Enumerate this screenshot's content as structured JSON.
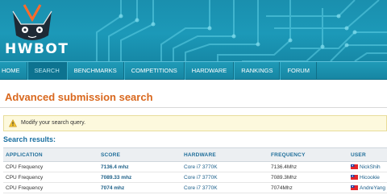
{
  "header": {
    "logo_text": "HWBOT",
    "logo_icon": "cat-face-icon",
    "colors": {
      "banner": "#1a8fae",
      "accent_orange": "#d9681e",
      "link_blue": "#1a6fa0"
    }
  },
  "nav": {
    "items": [
      {
        "label": "HOME",
        "active": false
      },
      {
        "label": "SEARCH",
        "active": true
      },
      {
        "label": "BENCHMARKS",
        "active": false
      },
      {
        "label": "COMPETITIONS",
        "active": false
      },
      {
        "label": "HARDWARE",
        "active": false
      },
      {
        "label": "RANKINGS",
        "active": false
      },
      {
        "label": "FORUM",
        "active": false
      }
    ]
  },
  "page": {
    "title": "Advanced submission search"
  },
  "notice": {
    "icon": "warning-icon",
    "text": "Modify your search query."
  },
  "results": {
    "title": "Search results:",
    "columns": [
      "APPLICATION",
      "SCORE",
      "HARDWARE",
      "FREQUENCY",
      "USER"
    ],
    "rows": [
      {
        "application": "CPU Frequency",
        "score": "7136.4 mhz",
        "hardware": "Core i7 3770K",
        "frequency": "7136.4Mhz",
        "flag": "taiwan-flag-icon",
        "user": "NickShih"
      },
      {
        "application": "CPU Frequency",
        "score": "7089.33 mhz",
        "hardware": "Core i7 3770K",
        "frequency": "7089.3Mhz",
        "flag": "taiwan-flag-icon",
        "user": "Hicookie"
      },
      {
        "application": "CPU Frequency",
        "score": "7074 mhz",
        "hardware": "Core i7 3770K",
        "frequency": "7074Mhz",
        "flag": "taiwan-flag-icon",
        "user": "AndreYang"
      }
    ]
  }
}
